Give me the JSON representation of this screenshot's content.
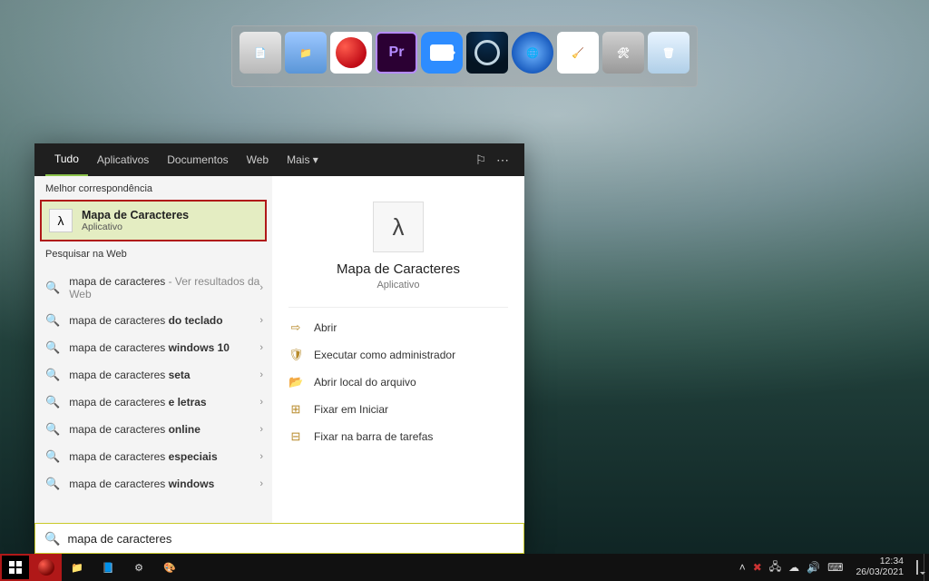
{
  "dock": {
    "apps": [
      "Notepad",
      "Folder",
      "Opera",
      "Premiere",
      "Zoom",
      "Steam",
      "Earth",
      "CCleaner",
      "Tools",
      "Recycle Bin"
    ]
  },
  "search": {
    "tabs": {
      "all": "Tudo",
      "apps": "Aplicativos",
      "docs": "Documentos",
      "web": "Web",
      "more": "Mais"
    },
    "feedback_icon": "feedback",
    "overflow_icon": "more",
    "best_header": "Melhor correspondência",
    "best": {
      "title": "Mapa de Caracteres",
      "subtitle": "Aplicativo"
    },
    "web_header": "Pesquisar na Web",
    "web_items": [
      {
        "prefix": "mapa de caracteres",
        "bold": "",
        "suffix": " - Ver resultados da Web",
        "dim": true
      },
      {
        "prefix": "mapa de caracteres ",
        "bold": "do teclado",
        "suffix": ""
      },
      {
        "prefix": "mapa de caracteres ",
        "bold": "windows 10",
        "suffix": ""
      },
      {
        "prefix": "mapa de caracteres ",
        "bold": "seta",
        "suffix": ""
      },
      {
        "prefix": "mapa de caracteres ",
        "bold": "e letras",
        "suffix": ""
      },
      {
        "prefix": "mapa de caracteres ",
        "bold": "online",
        "suffix": ""
      },
      {
        "prefix": "mapa de caracteres ",
        "bold": "especiais",
        "suffix": ""
      },
      {
        "prefix": "mapa de caracteres ",
        "bold": "windows",
        "suffix": ""
      }
    ],
    "hero": {
      "title": "Mapa de Caracteres",
      "subtitle": "Aplicativo"
    },
    "actions": {
      "open": "Abrir",
      "admin": "Executar como administrador",
      "loc": "Abrir local do arquivo",
      "pin_start": "Fixar em Iniciar",
      "pin_task": "Fixar na barra de tarefas"
    },
    "query": "mapa de caracteres"
  },
  "taskbar": {
    "tray_icons": [
      "up",
      "xbox",
      "net",
      "cloud",
      "sound",
      "lang"
    ],
    "time": "12:34",
    "date": "26/03/2021"
  }
}
